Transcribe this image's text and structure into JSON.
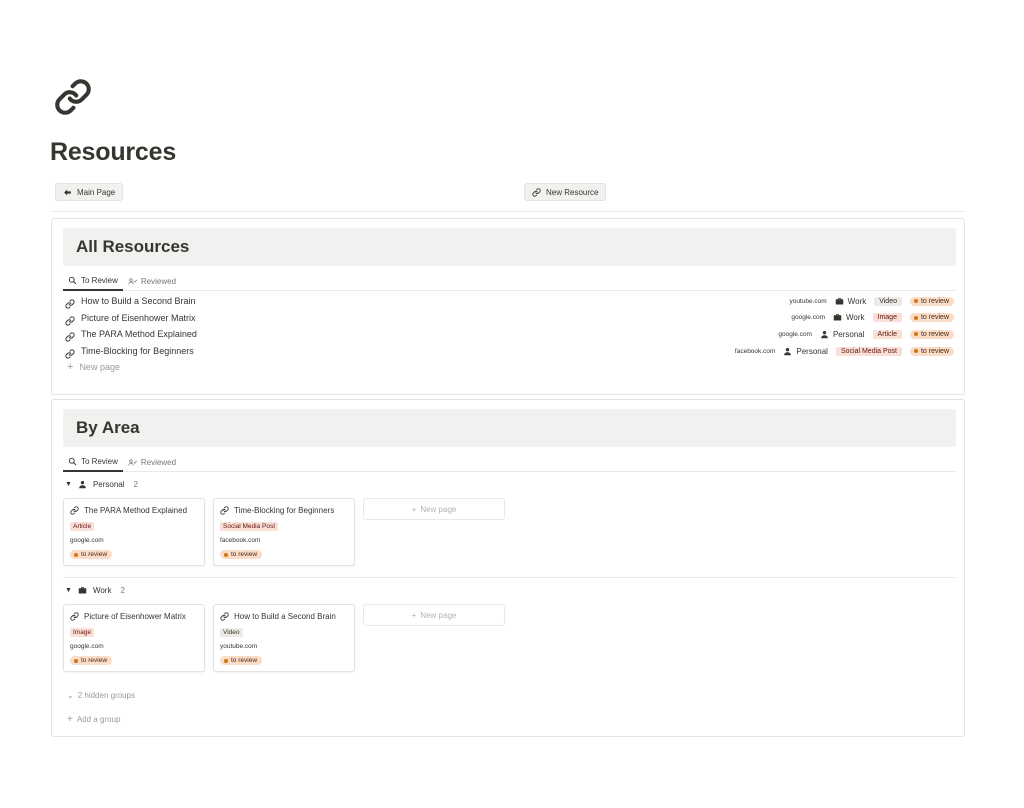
{
  "page": {
    "title": "Resources",
    "icon": "link-icon"
  },
  "buttons": {
    "main_page": "Main Page",
    "new_resource": "New Resource"
  },
  "colors": {
    "tag_gray": "#ede9e4",
    "tag_red": "#fadfd6",
    "status_bg": "#fadcc8",
    "status_dot": "#d9730d",
    "header_bg": "#f1f1ef"
  },
  "all_resources": {
    "title": "All Resources",
    "tabs": [
      "To Review",
      "Reviewed"
    ],
    "rows": [
      {
        "title": "How to Build a Second Brain",
        "url": "youtube.com",
        "area": "Work",
        "type": "Video",
        "status": "to review"
      },
      {
        "title": "Picture of Eisenhower Matrix",
        "url": "google.com",
        "area": "Work",
        "type": "Image",
        "status": "to review"
      },
      {
        "title": "The PARA Method Explained",
        "url": "google.com",
        "area": "Personal",
        "type": "Article",
        "status": "to review"
      },
      {
        "title": "Time-Blocking for Beginners",
        "url": "facebook.com",
        "area": "Personal",
        "type": "Social Media Post",
        "status": "to review"
      }
    ],
    "new_page": "New page"
  },
  "by_area": {
    "title": "By Area",
    "tabs": [
      "To Review",
      "Reviewed"
    ],
    "groups": [
      {
        "name": "Personal",
        "count": "2",
        "cards": [
          {
            "title": "The PARA Method Explained",
            "type": "Article",
            "url": "google.com",
            "status": "to review"
          },
          {
            "title": "Time-Blocking for Beginners",
            "type": "Social Media Post",
            "url": "facebook.com",
            "status": "to review"
          }
        ]
      },
      {
        "name": "Work",
        "count": "2",
        "cards": [
          {
            "title": "Picture of Eisenhower Matrix",
            "type": "Image",
            "url": "google.com",
            "status": "to review"
          },
          {
            "title": "How to Build a Second Brain",
            "type": "Video",
            "url": "youtube.com",
            "status": "to review"
          }
        ]
      }
    ],
    "new_page": "New page",
    "hidden_groups": "2 hidden groups",
    "add_group": "Add a group"
  }
}
